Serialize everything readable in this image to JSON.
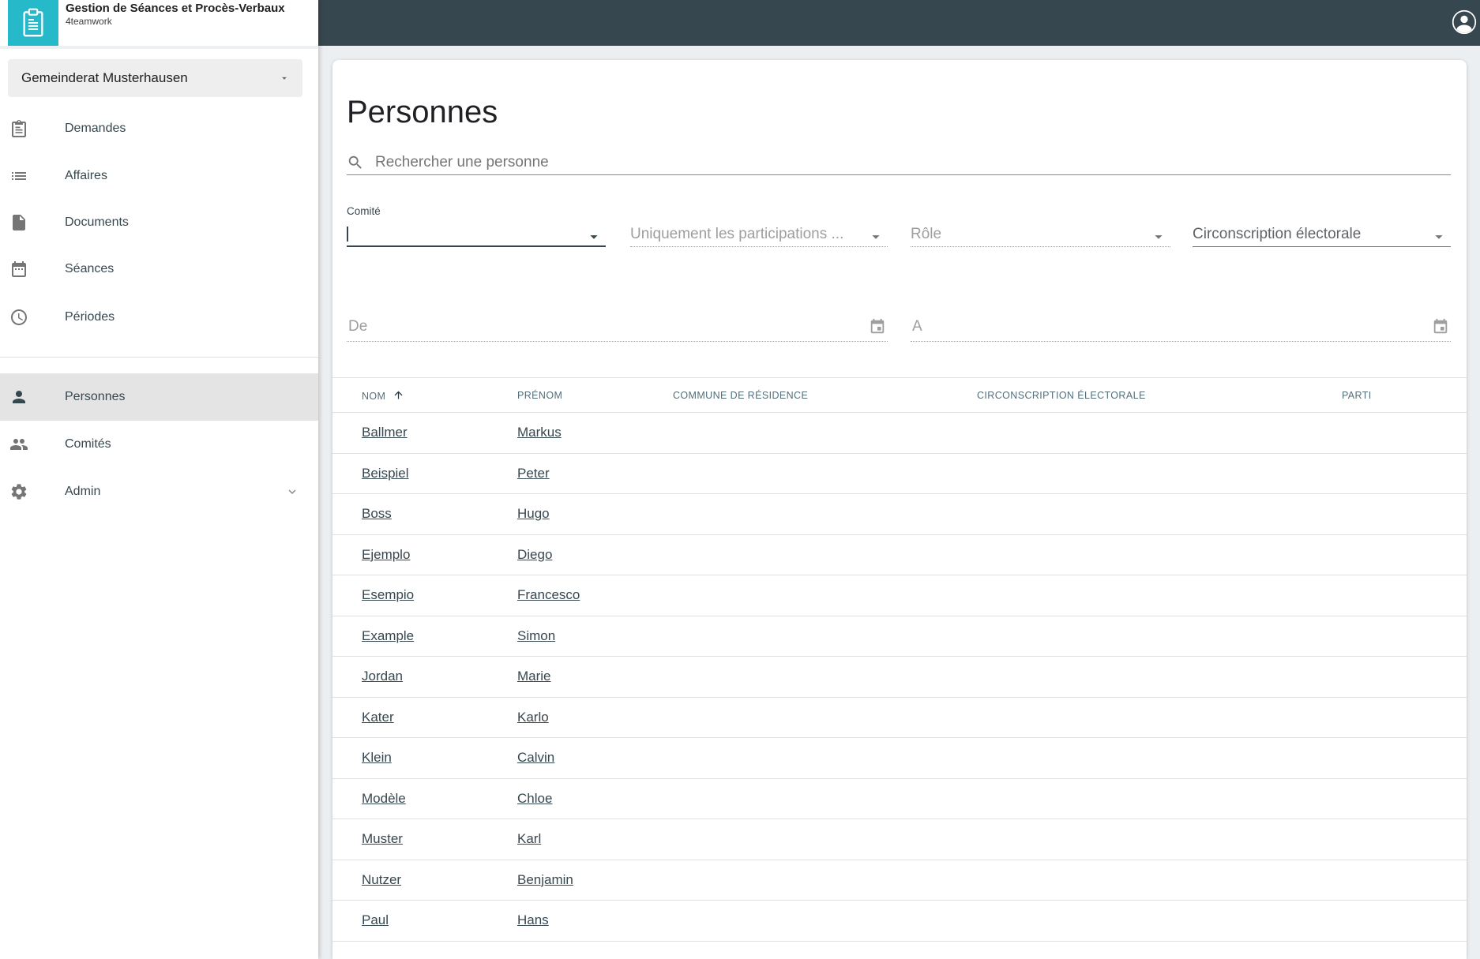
{
  "app": {
    "name": "Gestion de Séances et Procès-Verbaux",
    "vendor": "4teamwork"
  },
  "sidebar": {
    "workspace_selector": {
      "value": "Gemeinderat Musterhausen"
    },
    "primary_menu": [
      {
        "label": "Demandes",
        "icon": "clipboard-icon"
      },
      {
        "label": "Affaires",
        "icon": "list-icon"
      },
      {
        "label": "Documents",
        "icon": "document-icon"
      },
      {
        "label": "Séances",
        "icon": "calendar-icon"
      },
      {
        "label": "Périodes",
        "icon": "clock-icon"
      }
    ],
    "secondary_menu": [
      {
        "label": "Personnes",
        "icon": "person-icon",
        "selected": true
      },
      {
        "label": "Comités",
        "icon": "people-icon",
        "selected": false
      },
      {
        "label": "Admin",
        "icon": "gear-icon",
        "selected": false,
        "expandable": true
      }
    ]
  },
  "main": {
    "title": "Personnes",
    "search": {
      "placeholder": "Rechercher une personne"
    },
    "filters": {
      "comite": {
        "label": "Comité",
        "value": "",
        "state": "focused"
      },
      "participations": {
        "placeholder": "Uniquement les participations ..."
      },
      "role": {
        "placeholder": "Rôle"
      },
      "circonscription": {
        "placeholder": "Circonscription électorale"
      }
    },
    "date_range": {
      "from": {
        "placeholder": "De"
      },
      "to": {
        "placeholder": "A"
      }
    },
    "table": {
      "columns": [
        "NOM",
        "PRÉNOM",
        "COMMUNE DE RÉSIDENCE",
        "CIRCONSCRIPTION ÉLECTORALE",
        "PARTI"
      ],
      "sort": {
        "column": "NOM",
        "direction": "ascending"
      },
      "rows": [
        {
          "nom": "Ballmer",
          "prenom": "Markus",
          "commune": "",
          "circonscription": "",
          "parti": ""
        },
        {
          "nom": "Beispiel",
          "prenom": "Peter",
          "commune": "",
          "circonscription": "",
          "parti": ""
        },
        {
          "nom": "Boss",
          "prenom": "Hugo",
          "commune": "",
          "circonscription": "",
          "parti": ""
        },
        {
          "nom": "Ejemplo",
          "prenom": "Diego",
          "commune": "",
          "circonscription": "",
          "parti": ""
        },
        {
          "nom": "Esempio",
          "prenom": "Francesco",
          "commune": "",
          "circonscription": "",
          "parti": ""
        },
        {
          "nom": "Example",
          "prenom": "Simon",
          "commune": "",
          "circonscription": "",
          "parti": ""
        },
        {
          "nom": "Jordan",
          "prenom": "Marie",
          "commune": "",
          "circonscription": "",
          "parti": ""
        },
        {
          "nom": "Kater",
          "prenom": "Karlo",
          "commune": "",
          "circonscription": "",
          "parti": ""
        },
        {
          "nom": "Klein",
          "prenom": "Calvin",
          "commune": "",
          "circonscription": "",
          "parti": ""
        },
        {
          "nom": "Modèle",
          "prenom": "Chloe",
          "commune": "",
          "circonscription": "",
          "parti": ""
        },
        {
          "nom": "Muster",
          "prenom": "Karl",
          "commune": "",
          "circonscription": "",
          "parti": ""
        },
        {
          "nom": "Nutzer",
          "prenom": "Benjamin",
          "commune": "",
          "circonscription": "",
          "parti": ""
        },
        {
          "nom": "Paul",
          "prenom": "Hans",
          "commune": "",
          "circonscription": "",
          "parti": ""
        }
      ]
    }
  },
  "colors": {
    "brand_teal": "#25B9C9",
    "topbar": "#37474F",
    "page_background": "#ECEFF1",
    "selected_item_background": "#E4E4E4",
    "link_text": "#37474F",
    "placeholder_gray": "#9E9E9E"
  }
}
